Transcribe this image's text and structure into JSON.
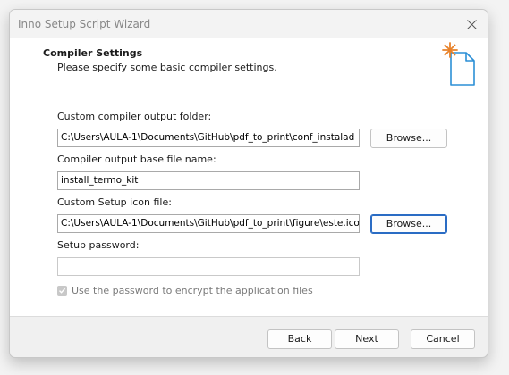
{
  "window": {
    "title": "Inno Setup Script Wizard"
  },
  "header": {
    "title": "Compiler Settings",
    "subtitle": "Please specify some basic compiler settings."
  },
  "fields": {
    "output_folder": {
      "label": "Custom compiler output folder:",
      "value": "C:\\Users\\AULA-1\\Documents\\GitHub\\pdf_to_print\\conf_instalad"
    },
    "output_base_name": {
      "label": "Compiler output base file name:",
      "value": "install_termo_kit"
    },
    "setup_icon": {
      "label": "Custom Setup icon file:",
      "value": "C:\\Users\\AULA-1\\Documents\\GitHub\\pdf_to_print\\figure\\este.ico"
    },
    "setup_password": {
      "label": "Setup password:",
      "value": ""
    }
  },
  "checkbox": {
    "label": "Use the password to encrypt the application files",
    "checked": true,
    "enabled": false
  },
  "buttons": {
    "browse_output": "Browse...",
    "browse_icon": "Browse...",
    "back": "Back",
    "next": "Next",
    "cancel": "Cancel"
  },
  "colors": {
    "focus_border": "#2a6cc4",
    "wizard_icon_star": "#e8822a",
    "wizard_icon_page": "#2b8fd6"
  },
  "icons": {
    "close": "close-icon",
    "wizard": "new-document-icon",
    "check": "check-icon"
  }
}
